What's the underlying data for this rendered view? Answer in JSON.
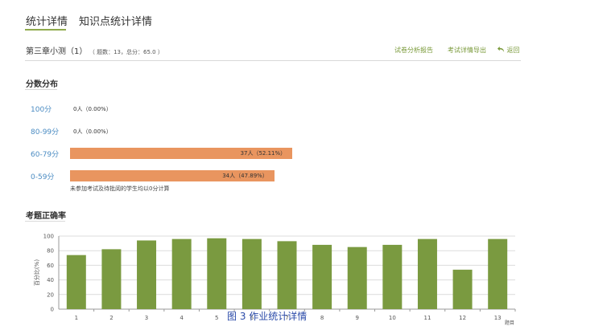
{
  "tabs": [
    {
      "label": "统计详情",
      "active": true
    },
    {
      "label": "知识点统计详情",
      "active": false
    }
  ],
  "header": {
    "test_name": "第三章小测（1）",
    "meta": "（ 题数：13，总分：65.0 ）",
    "actions": {
      "report": "试卷分析报告",
      "export": "考试详情导出",
      "back": "返回"
    }
  },
  "score_distribution": {
    "title": "分数分布",
    "rows": [
      {
        "range": "100分",
        "text": "0人（0.00%）",
        "percent": 0.0
      },
      {
        "range": "80-99分",
        "text": "0人（0.00%）",
        "percent": 0.0
      },
      {
        "range": "60-79分",
        "text": "37人（52.11%）",
        "percent": 52.11
      },
      {
        "range": "0-59分",
        "text": "34人（47.89%）",
        "percent": 47.89
      }
    ],
    "note": "未参加考试及待批阅的学生均以0分计算"
  },
  "accuracy": {
    "title": "考题正确率"
  },
  "chart_data": {
    "type": "bar",
    "title": "",
    "ylabel": "百分比(%)",
    "xlabel": "题目",
    "ylim": [
      0,
      100
    ],
    "yticks": [
      0,
      20,
      40,
      60,
      80,
      100
    ],
    "categories": [
      "1",
      "2",
      "3",
      "4",
      "5",
      "6",
      "7",
      "8",
      "9",
      "10",
      "11",
      "12",
      "13"
    ],
    "values": [
      74,
      82,
      94,
      96,
      97,
      96,
      93,
      88,
      85,
      88,
      96,
      54,
      96
    ],
    "grid": true
  },
  "caption": "图 3 作业统计详情",
  "colors": {
    "tab_underline": "#8faa4b",
    "link_green": "#7a9a3a",
    "range_blue": "#4a8bc2",
    "dist_bar": "#e9955f",
    "chart_bar": "#7a9a40",
    "caption_blue": "#2a4aa8"
  },
  "icons": {
    "back": "undo-arrow-icon"
  }
}
